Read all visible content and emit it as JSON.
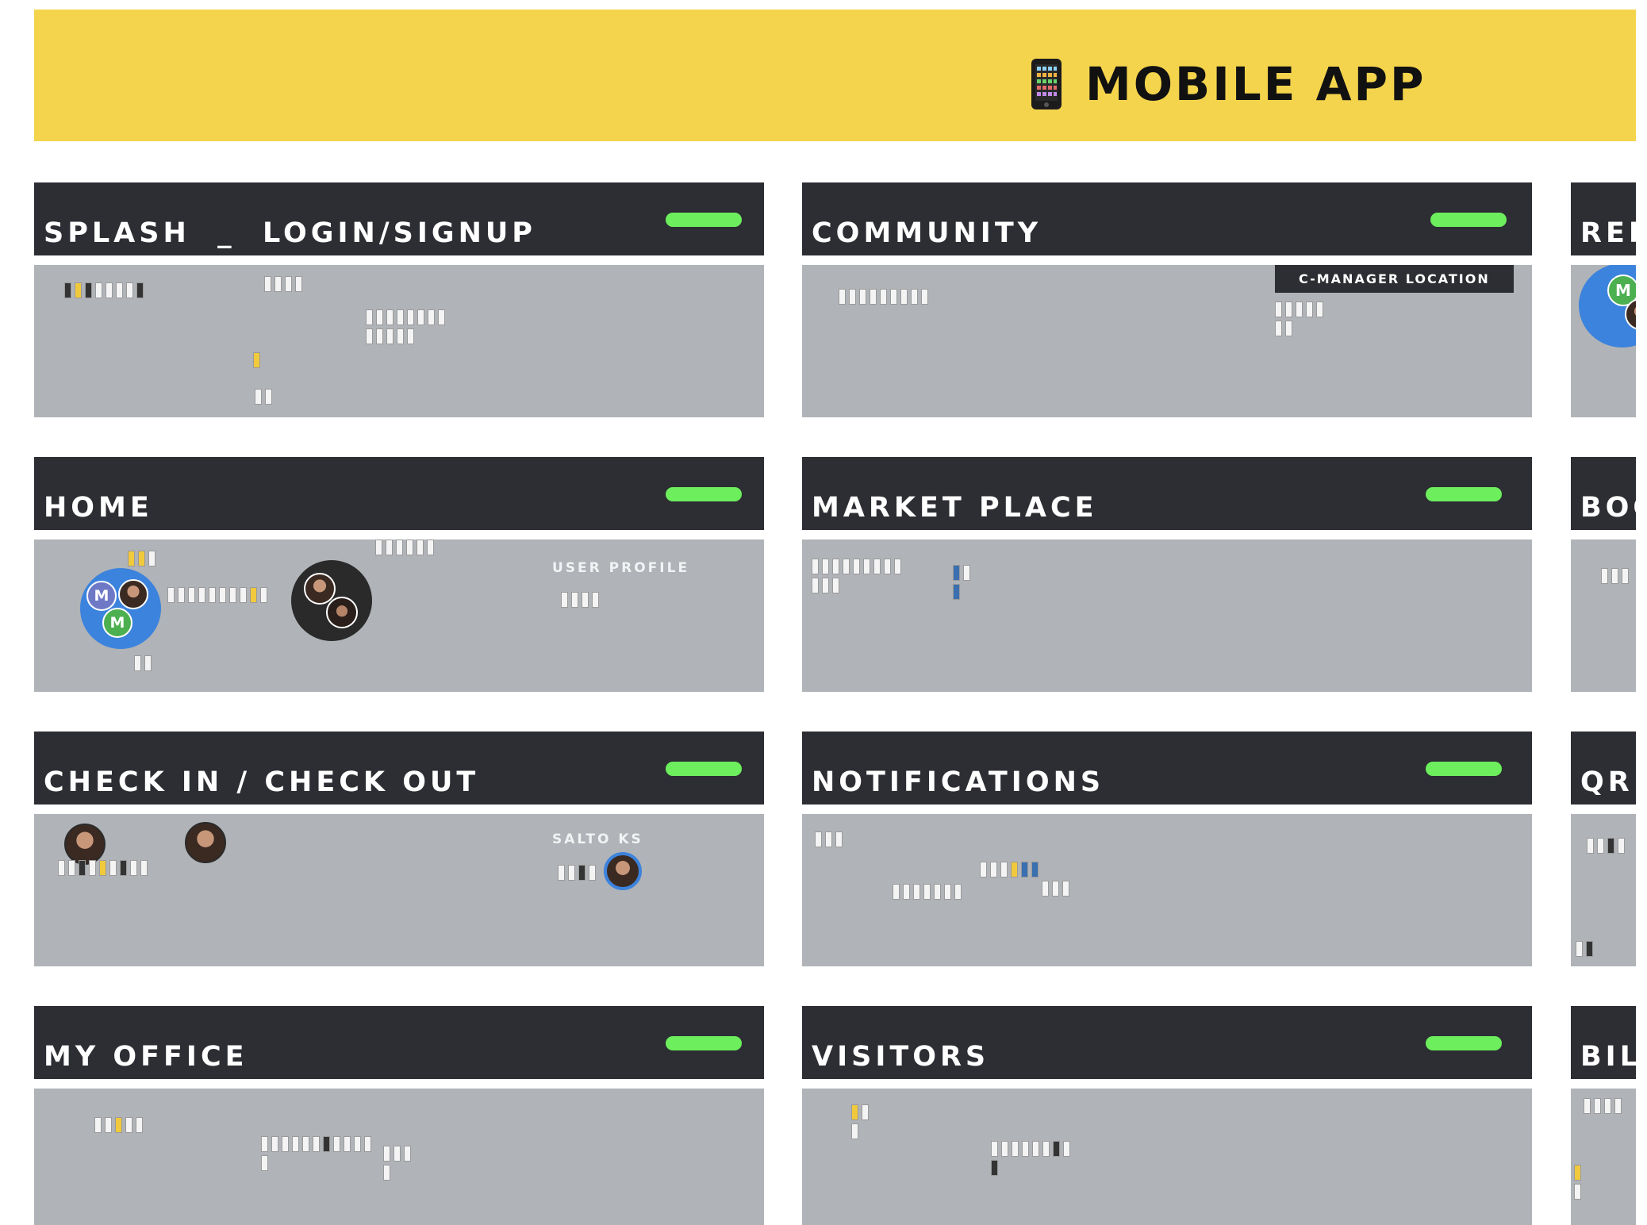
{
  "banner": {
    "title": "MOBILE APP",
    "icon": "mobile-phone-icon"
  },
  "colors": {
    "banner": "#f4d44c",
    "header": "#2c2e33",
    "body": "#b0b3b7",
    "status_pill": "#6dee5d"
  },
  "sections": {
    "splash": {
      "title": "SPLASH  _  LOGIN/SIGNUP"
    },
    "community": {
      "title": "COMMUNITY",
      "tag": "C-MANAGER LOCATION"
    },
    "rep": {
      "title": "REP"
    },
    "home": {
      "title": "HOME",
      "sublabel": "USER PROFILE"
    },
    "market": {
      "title": "MARKET PLACE"
    },
    "boo": {
      "title": "BOO"
    },
    "checkin": {
      "title": "CHECK IN / CHECK OUT",
      "sublabel": "SALTO KS"
    },
    "notifications": {
      "title": "NOTIFICATIONS"
    },
    "qr": {
      "title": "QR"
    },
    "office": {
      "title": "MY OFFICE"
    },
    "visitors": {
      "title": "VISITORS"
    },
    "bil": {
      "title": "BIL"
    }
  },
  "avatars": {
    "m_letter": "M"
  }
}
